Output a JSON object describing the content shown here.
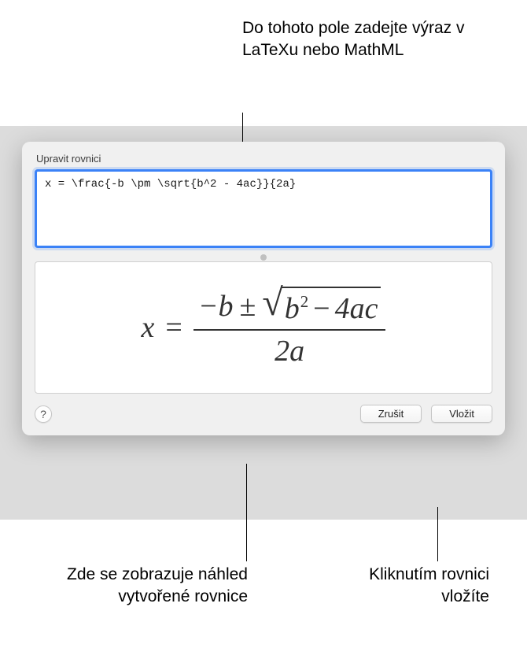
{
  "annotations": {
    "top": "Do tohoto pole zadejte výraz v LaTeXu nebo MathML",
    "bottomLeft": "Zde se zobrazuje náhled vytvořené rovnice",
    "bottomRight": "Kliknutím rovnici vložíte"
  },
  "dialog": {
    "title": "Upravit rovnici",
    "inputValue": "x = \\frac{-b \\pm \\sqrt{b^2 - 4ac}}{2a}",
    "helpLabel": "?",
    "cancelLabel": "Zrušit",
    "insertLabel": "Vložit"
  },
  "preview": {
    "lhs": "x",
    "eq": "=",
    "negB": "−b",
    "pm": "±",
    "b": "b",
    "sq": "2",
    "minus": "−",
    "fourAC": "4ac",
    "den": "2a"
  }
}
